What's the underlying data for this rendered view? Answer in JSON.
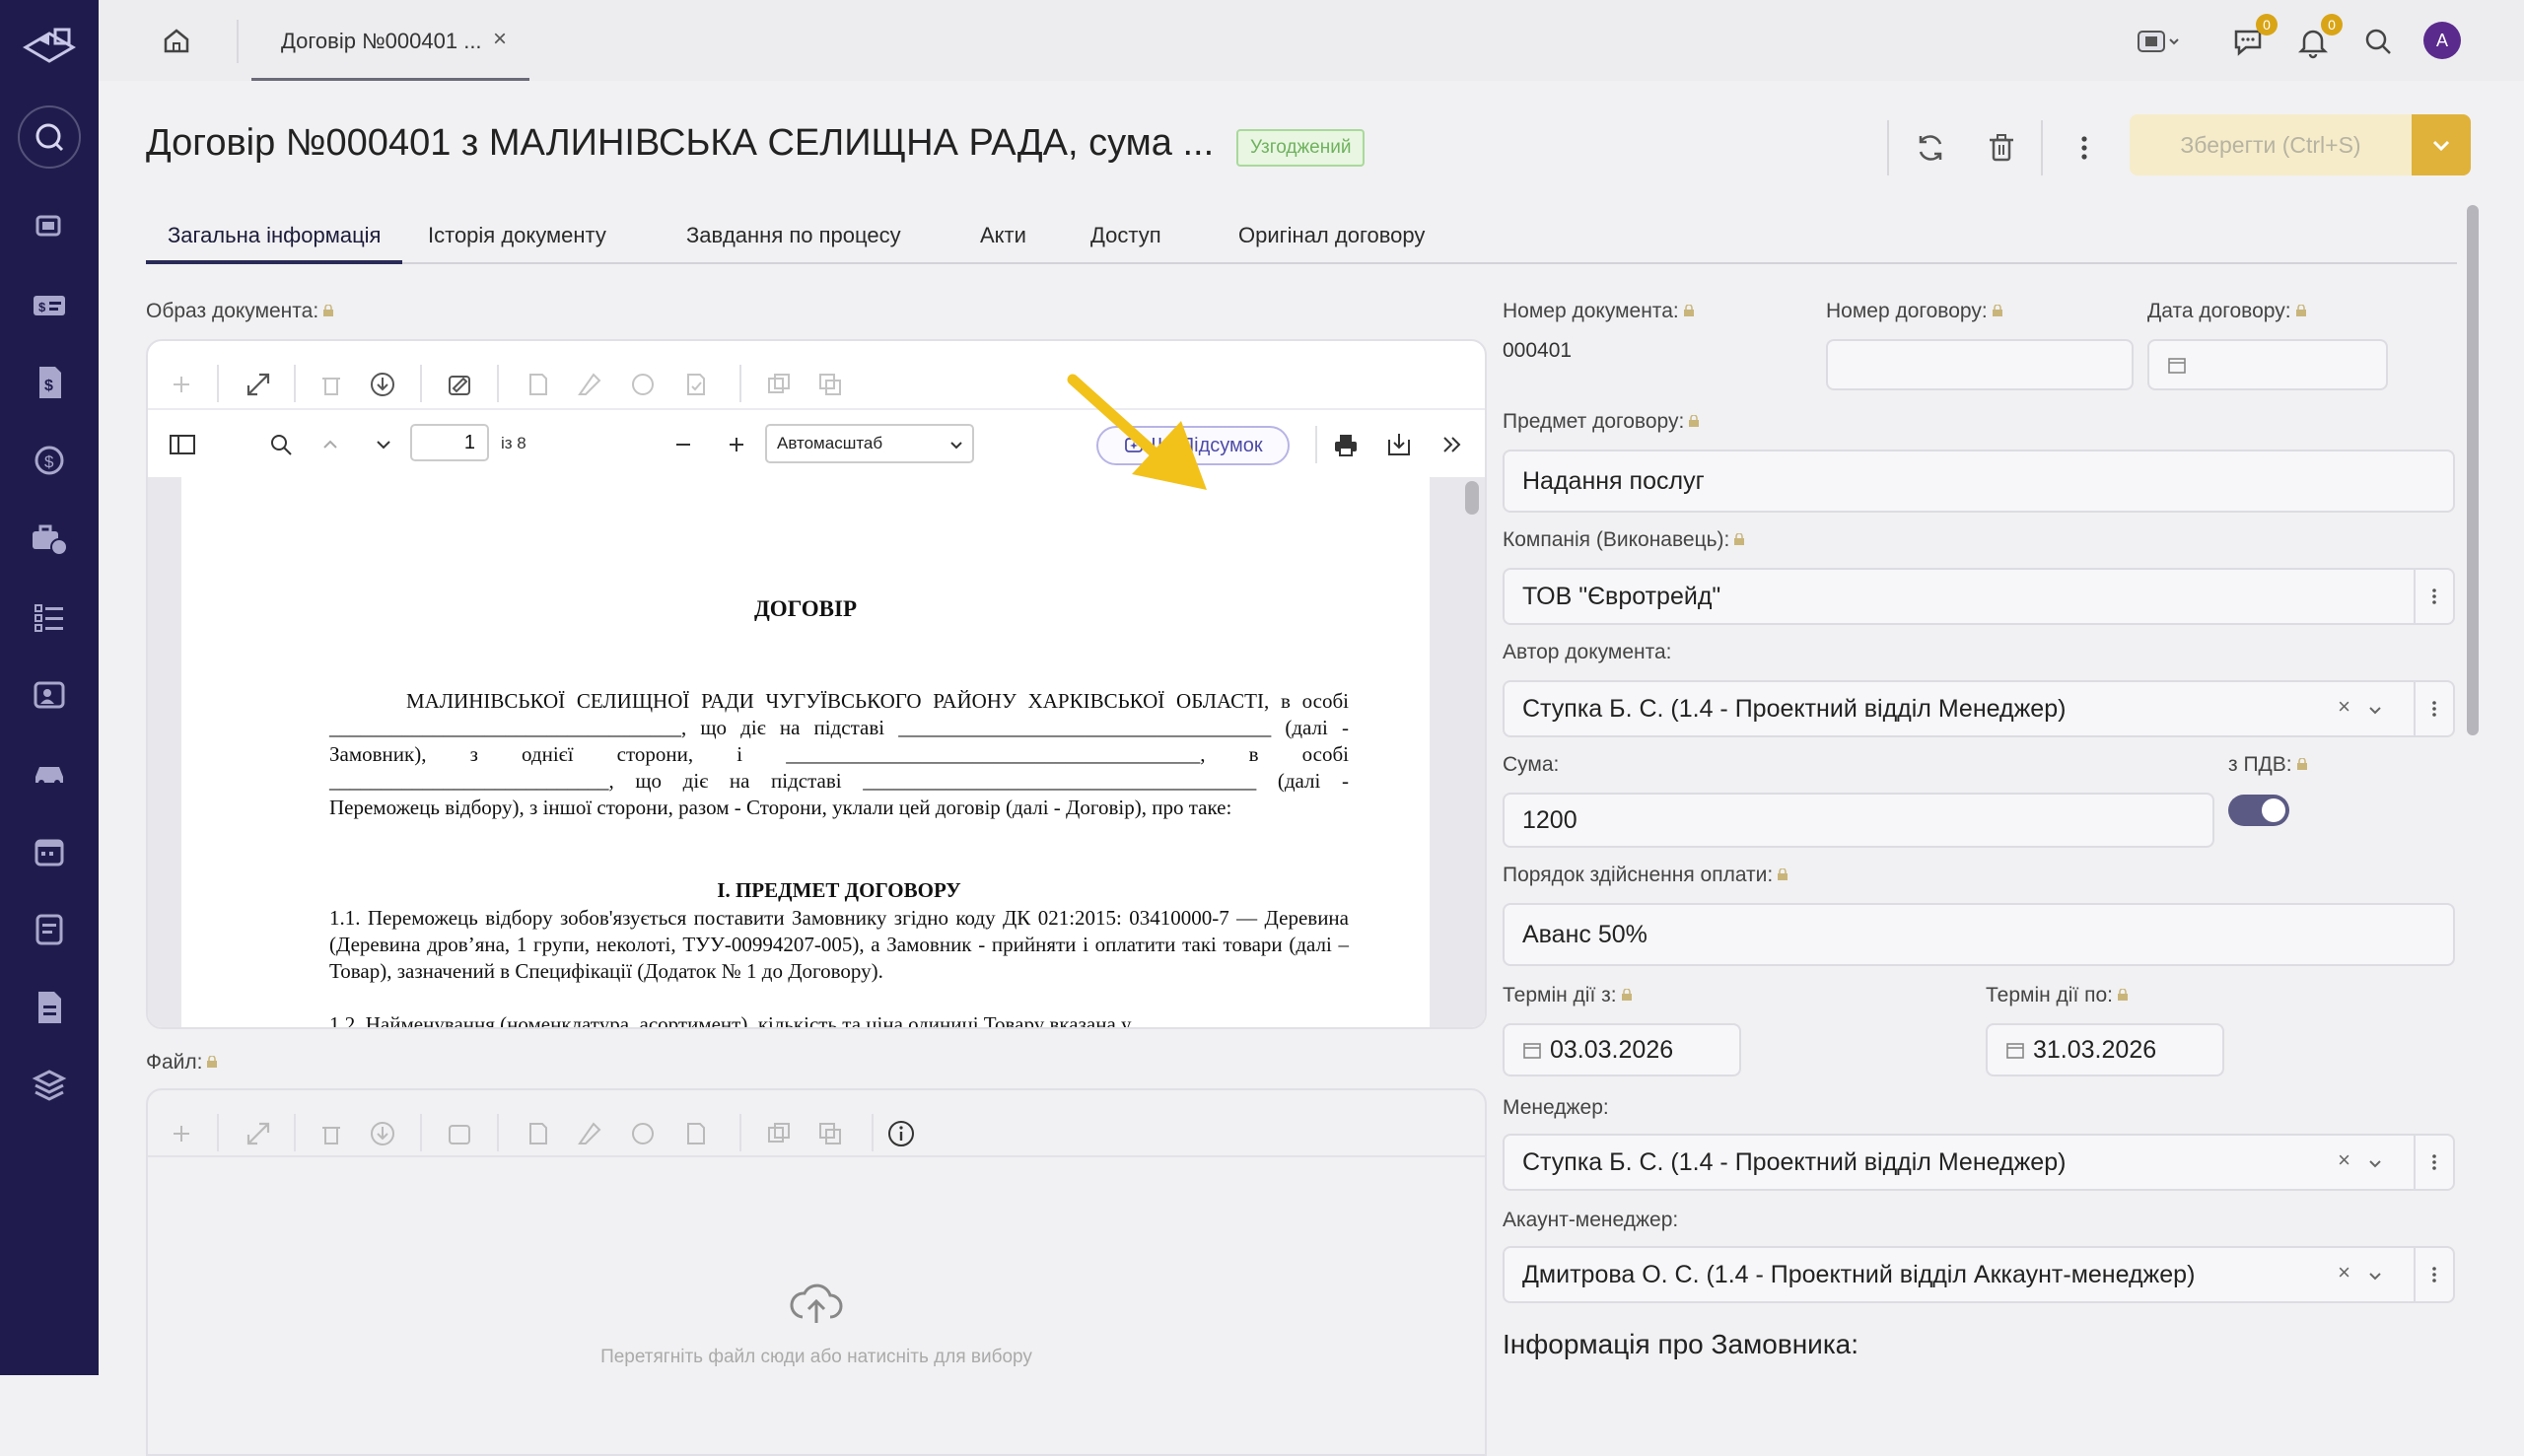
{
  "tab": {
    "title": "Договір №000401 ...",
    "close": "×"
  },
  "top": {
    "chat_count": "0",
    "notif_count": "0",
    "avatar": "A"
  },
  "header": {
    "title": "Договір №000401 з МАЛИНІВСЬКА СЕЛИЩНА РАДА, сума ...",
    "status": "Узгоджений",
    "save_label": "Зберегти (Ctrl+S)"
  },
  "tabs": [
    "Загальна інформація",
    "Історія документу",
    "Завдання по процесу",
    "Акти",
    "Доступ",
    "Оригінал договору"
  ],
  "doc_image": {
    "label": "Образ документа:",
    "page": "1",
    "page_of": "із 8",
    "zoom": "Автомасштаб",
    "ai_button": "ШІ Підсумок",
    "pdf": {
      "title": "ДОГОВІР",
      "para1": "МАЛИНІВСЬКОЇ СЕЛИЩНОЇ РАДИ ЧУГУЇВСЬКОГО РАЙОНУ ХАРКІВСЬКОЇ ОБЛАСТІ, в особі __________________________________, що діє на підставі ____________________________________ (далі - Замовник), з однієї сторони, і ________________________________________, в особі ___________________________, що діє на підставі ______________________________________ (далі - Переможець відбору), з іншої сторони, разом - Сторони, уклали цей договір (далі - Договір), про таке:",
      "section": "І.          ПРЕДМЕТ ДОГОВОРУ",
      "para2": "1.1. Переможець відбору зобов'язується поставити Замовнику згідно коду ДК 021:2015: 03410000-7 — Деревина (Деревина дров’яна, 1 групи, неколоті, ТУУ-00994207-005), а Замовник - прийняти і оплатити такі товари (далі – Товар), зазначений в Специфікації (Додаток № 1 до Договору).",
      "para3": "1.2. Найменування (номенклатура, асортимент), кількість та ціна одиниці Товару вказана у"
    }
  },
  "file": {
    "label": "Файл:",
    "upload_text": "Перетягніть файл сюди або натисніть для вибору"
  },
  "form": {
    "doc_number_label": "Номер документа:",
    "doc_number": "000401",
    "contract_number_label": "Номер договору:",
    "contract_date_label": "Дата договору:",
    "subject_label": "Предмет договору:",
    "subject": "Надання послуг",
    "company_label": "Компанія (Виконавець):",
    "company": "ТОВ \"Євротрейд\"",
    "author_label": "Автор документа:",
    "author": "Ступка Б. С. (1.4 - Проектний відділ Менеджер)",
    "sum_label": "Сума:",
    "sum": "1200",
    "vat_label": "з ПДВ:",
    "vat_on": true,
    "payment_label": "Порядок здійснення оплати:",
    "payment": "Аванс 50%",
    "valid_from_label": "Термін дії з:",
    "valid_from": "03.03.2026",
    "valid_to_label": "Термін дії по:",
    "valid_to": "31.03.2026",
    "manager_label": "Менеджер:",
    "manager": "Ступка Б. С. (1.4 - Проектний відділ Менеджер)",
    "account_manager_label": "Акаунт-менеджер:",
    "account_manager": "Дмитрова О. С. (1.4 - Проектний відділ Аккаунт-менеджер)",
    "customer_info_heading": "Інформація про Замовника:"
  },
  "colors": {
    "sidebar": "#1f1c4d",
    "accent": "#e0b23a",
    "status_green": "#6fb25d",
    "arrow": "#f2c21b"
  },
  "icons": [
    "logo-icon",
    "search-icon",
    "home-icon",
    "sync-icon",
    "trash-icon",
    "more-vertical-icon",
    "chevron-down-icon",
    "calendar-icon",
    "lock-icon",
    "upload-cloud-icon",
    "print-icon",
    "download-icon",
    "double-chevron-right-icon"
  ]
}
